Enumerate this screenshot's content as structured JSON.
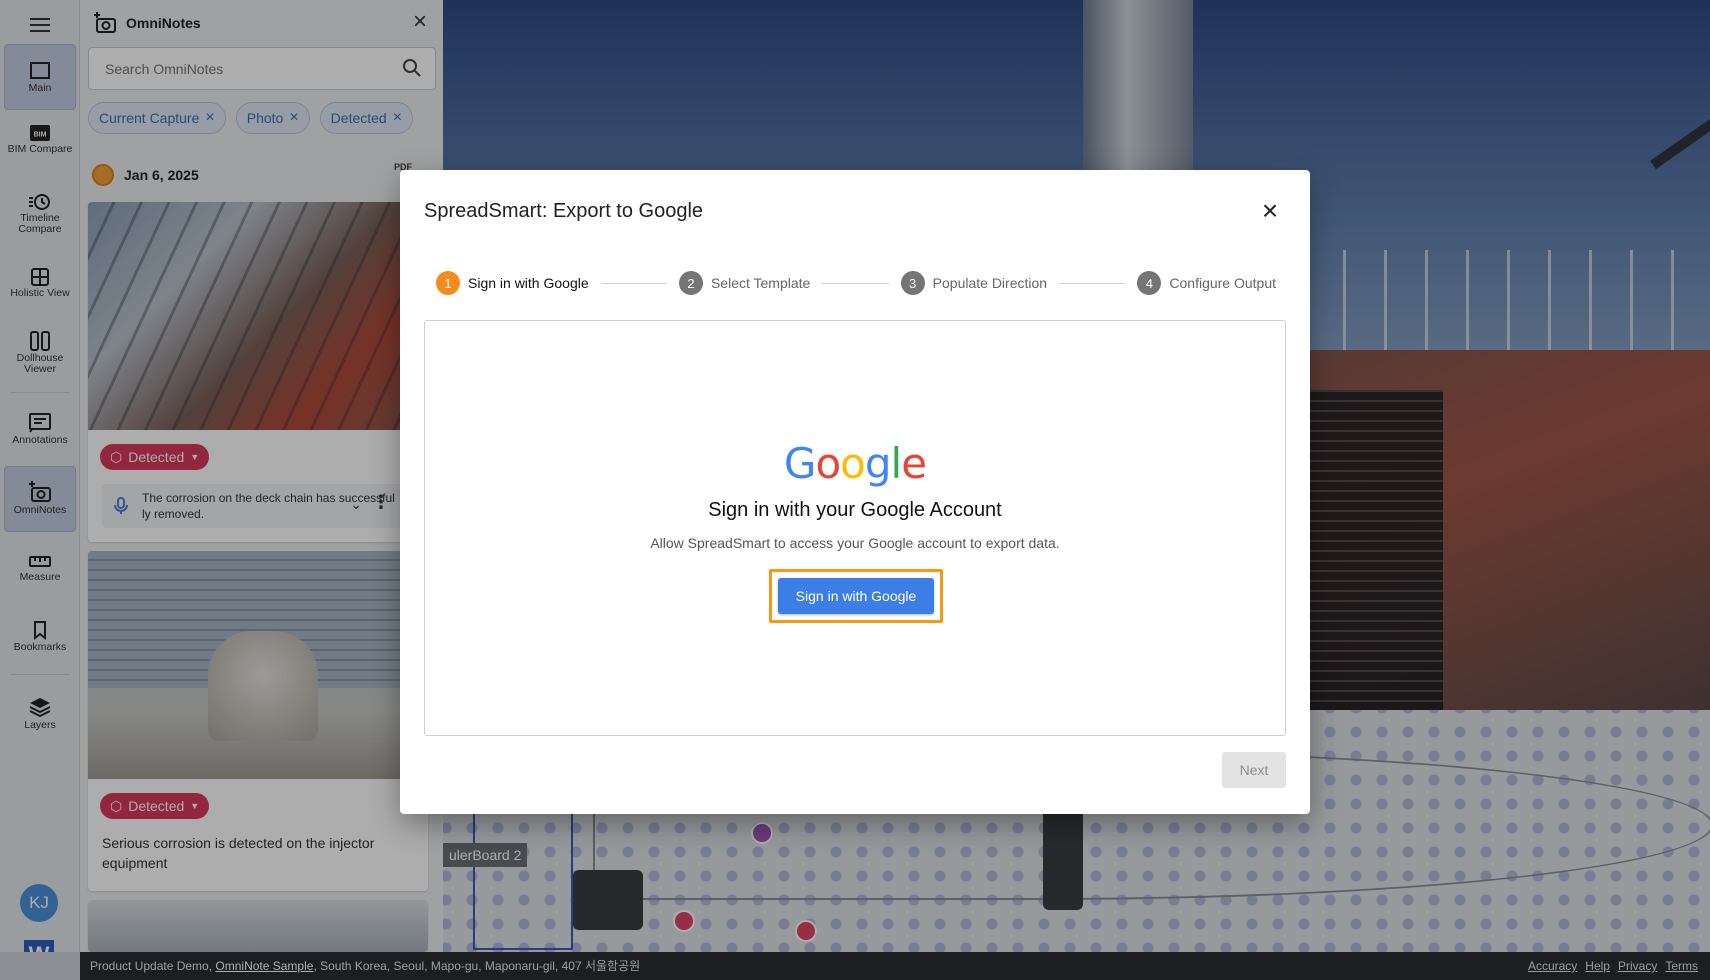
{
  "rail": {
    "items": [
      {
        "label": "Main"
      },
      {
        "label": "BIM Compare"
      },
      {
        "label": "Timeline Compare"
      },
      {
        "label": "Holistic View"
      },
      {
        "label": "Dollhouse Viewer"
      },
      {
        "label": "Annotations"
      },
      {
        "label": "OmniNotes"
      },
      {
        "label": "Measure"
      },
      {
        "label": "Bookmarks"
      },
      {
        "label": "Layers"
      }
    ],
    "avatar_initials": "KJ",
    "logo_letter": "W"
  },
  "panel": {
    "title": "OmniNotes",
    "search_placeholder": "Search OmniNotes",
    "chips": [
      "Current Capture",
      "Photo",
      "Detected"
    ],
    "date": "Jan 6, 2025",
    "pdf_label": "PDF",
    "cards": [
      {
        "tag": "Detected",
        "note": "The corrosion on the deck chain has successfully removed."
      },
      {
        "tag": "Detected",
        "note": "Serious corrosion is detected on the injector equipment"
      }
    ]
  },
  "plan": {
    "label": "ulerBoard 2"
  },
  "footer": {
    "prefix": "Product Update Demo, ",
    "link": "OmniNote Sample",
    "suffix": ", South Korea, Seoul, Mapo-gu, Maponaru-gil, 407 서울함공원",
    "links": [
      "Accuracy",
      "Help",
      "Privacy",
      "Terms"
    ]
  },
  "modal": {
    "title": "SpreadSmart: Export to Google",
    "steps": [
      {
        "num": "1",
        "label": "Sign in with Google"
      },
      {
        "num": "2",
        "label": "Select Template"
      },
      {
        "num": "3",
        "label": "Populate Direction"
      },
      {
        "num": "4",
        "label": "Configure Output"
      }
    ],
    "logo_letters": [
      "G",
      "o",
      "o",
      "g",
      "l",
      "e"
    ],
    "sign_title": "Sign in with your Google Account",
    "sign_desc": "Allow SpreadSmart to access your Google account to export data.",
    "sign_button": "Sign in with Google",
    "next_button": "Next"
  },
  "colors": {
    "accent": "#3d7ee6",
    "step_active": "#f48b1e",
    "highlight": "#f59a14",
    "tag": "#d9385e"
  }
}
